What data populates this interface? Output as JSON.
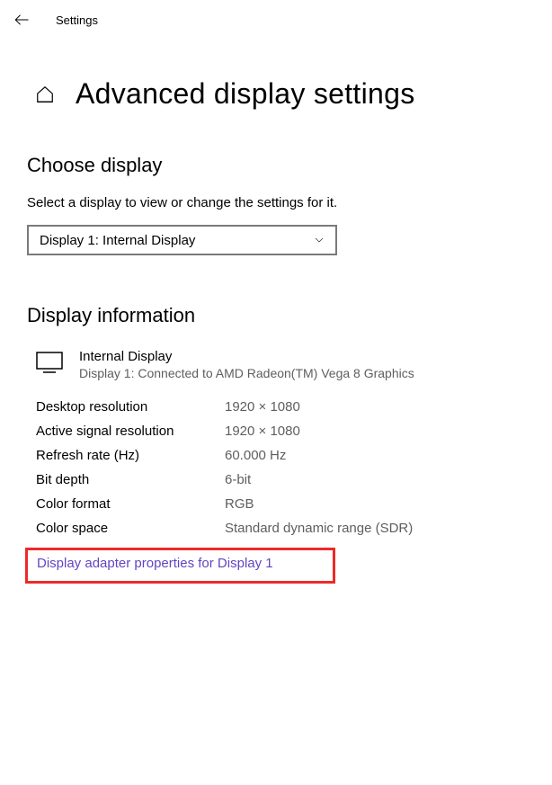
{
  "header": {
    "title": "Settings"
  },
  "page": {
    "title": "Advanced display settings"
  },
  "choose_display": {
    "heading": "Choose display",
    "instruction": "Select a display to view or change the settings for it.",
    "selected": "Display 1: Internal Display"
  },
  "display_information": {
    "heading": "Display information",
    "name": "Internal Display",
    "connected_text": "Display 1: Connected to AMD Radeon(TM) Vega 8 Graphics",
    "rows": [
      {
        "label": "Desktop resolution",
        "value": "1920 × 1080"
      },
      {
        "label": "Active signal resolution",
        "value": "1920 × 1080"
      },
      {
        "label": "Refresh rate (Hz)",
        "value": "60.000 Hz"
      },
      {
        "label": "Bit depth",
        "value": "6-bit"
      },
      {
        "label": "Color format",
        "value": "RGB"
      },
      {
        "label": "Color space",
        "value": "Standard dynamic range (SDR)"
      }
    ],
    "adapter_link": "Display adapter properties for Display 1"
  }
}
